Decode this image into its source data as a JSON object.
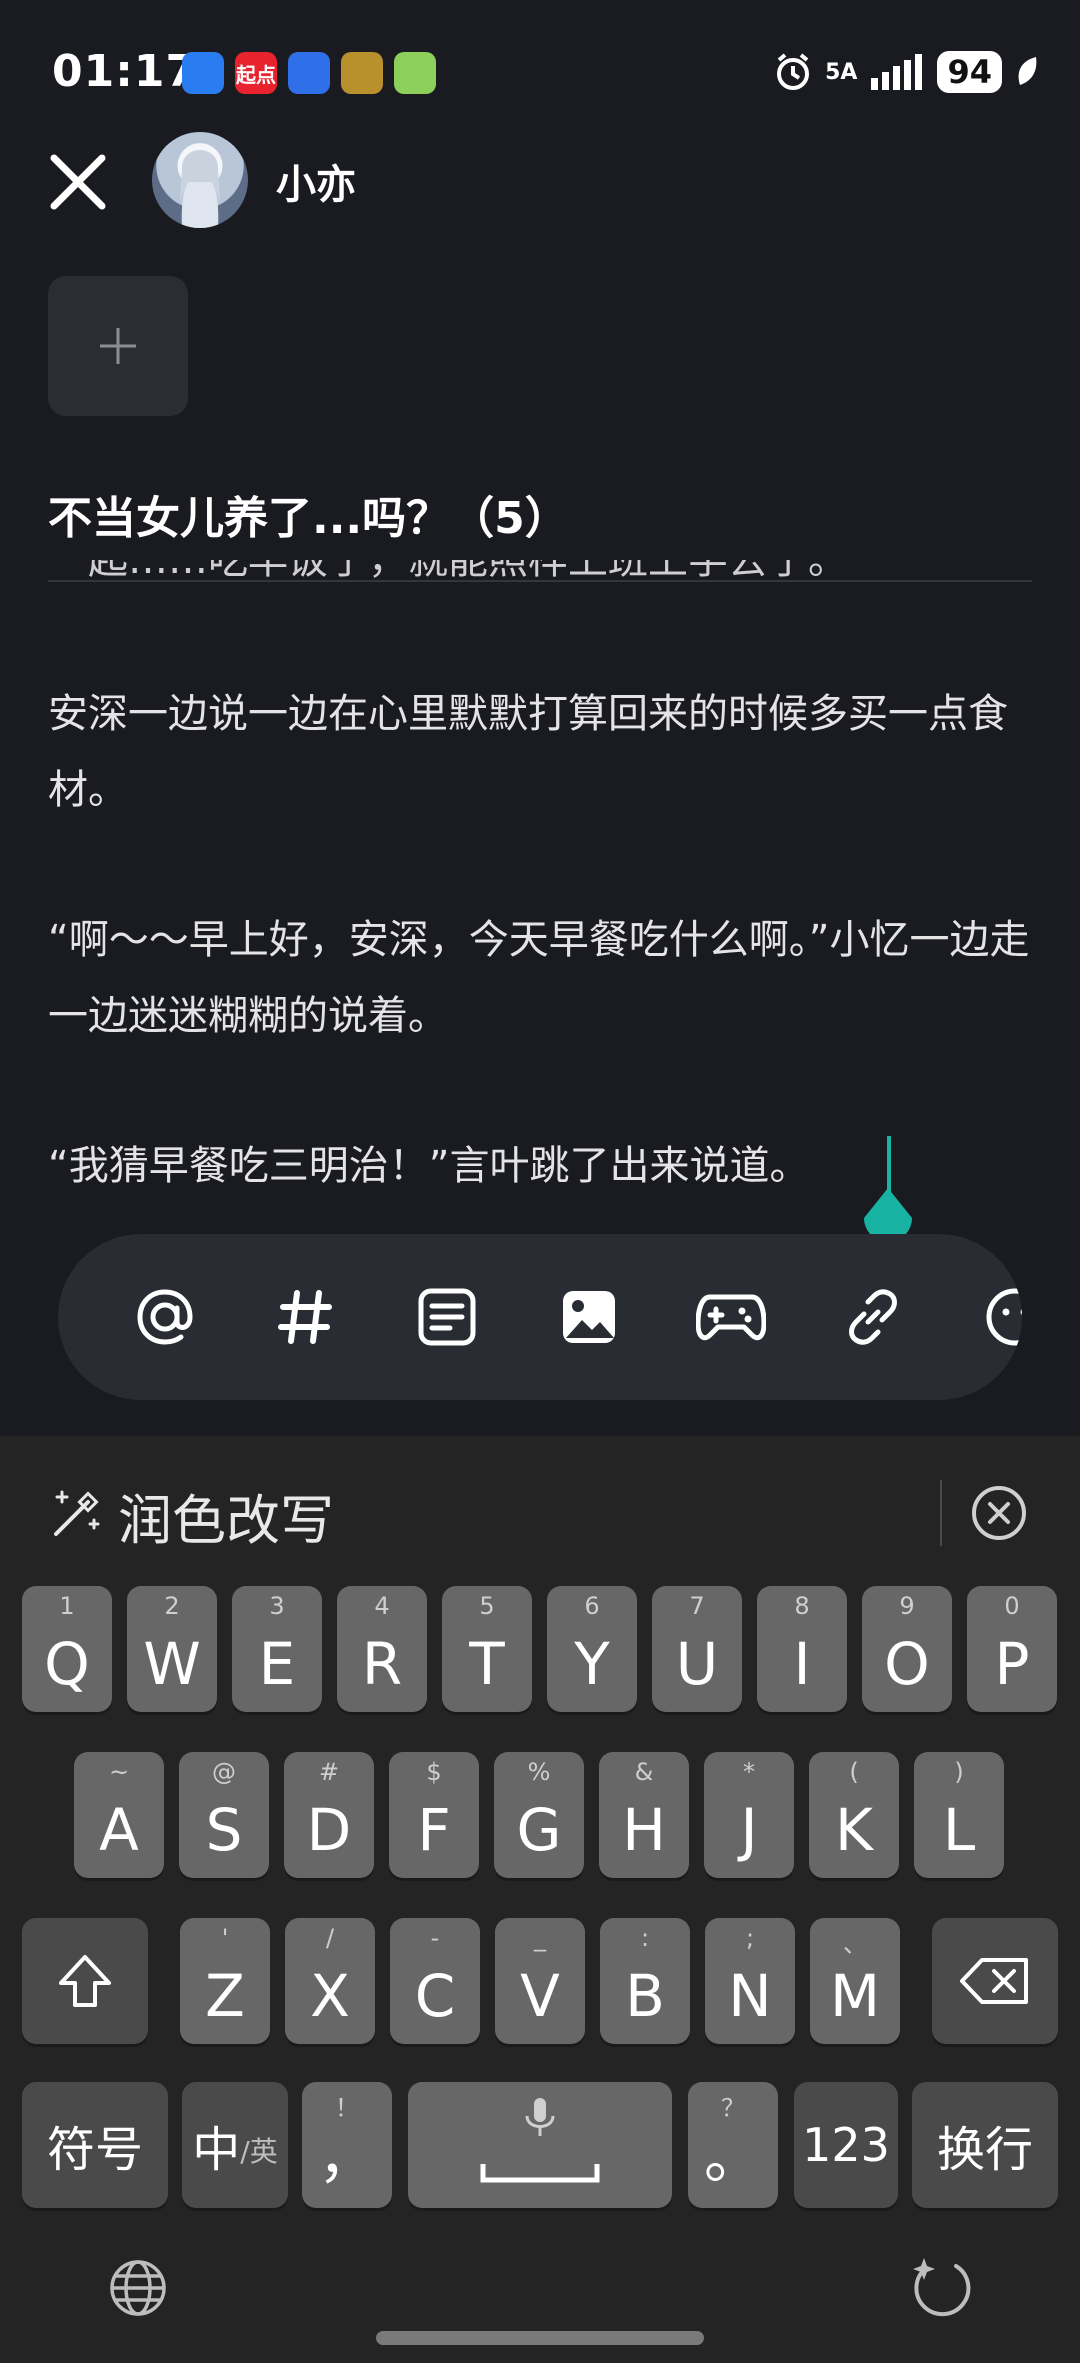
{
  "status_bar": {
    "time": "01:17",
    "network": "5A",
    "battery": "94",
    "app_icons": [
      {
        "name": "message-app-icon",
        "color": "#2a7df0",
        "text": ""
      },
      {
        "name": "qidian-app-icon",
        "color": "#e8232d",
        "text": "起点"
      },
      {
        "name": "upload-app-icon",
        "color": "#2f6fe8",
        "text": ""
      },
      {
        "name": "game-app-icon",
        "color": "#b8912d",
        "text": ""
      },
      {
        "name": "green-app-icon",
        "color": "#8ccf5a",
        "text": ""
      }
    ]
  },
  "header": {
    "username": "小亦"
  },
  "post": {
    "title": "不当女儿养了...吗？（5）",
    "cut_line": "一起……吃早饭了，就能照样上班上学去了。",
    "paragraphs": [
      "安深一边说一边在心里默默打算回来的时候多买一点食材。",
      "“啊～～早上好，安深，今天早餐吃什么啊。”小忆一边走一边迷迷糊糊的说着。",
      "“我猜早餐吃三明治！”言叶跳了出来说道。"
    ]
  },
  "keyboard": {
    "polish_label": "润色改写",
    "row1": [
      {
        "k": "Q",
        "s": "1"
      },
      {
        "k": "W",
        "s": "2"
      },
      {
        "k": "E",
        "s": "3"
      },
      {
        "k": "R",
        "s": "4"
      },
      {
        "k": "T",
        "s": "5"
      },
      {
        "k": "Y",
        "s": "6"
      },
      {
        "k": "U",
        "s": "7"
      },
      {
        "k": "I",
        "s": "8"
      },
      {
        "k": "O",
        "s": "9"
      },
      {
        "k": "P",
        "s": "0"
      }
    ],
    "row2": [
      {
        "k": "A",
        "s": "~"
      },
      {
        "k": "S",
        "s": "@"
      },
      {
        "k": "D",
        "s": "#"
      },
      {
        "k": "F",
        "s": "$"
      },
      {
        "k": "G",
        "s": "%"
      },
      {
        "k": "H",
        "s": "&"
      },
      {
        "k": "J",
        "s": "*"
      },
      {
        "k": "K",
        "s": "("
      },
      {
        "k": "L",
        "s": ")"
      }
    ],
    "row3": [
      {
        "k": "Z",
        "s": "'"
      },
      {
        "k": "X",
        "s": "/"
      },
      {
        "k": "C",
        "s": "-"
      },
      {
        "k": "V",
        "s": "_"
      },
      {
        "k": "B",
        "s": ":"
      },
      {
        "k": "N",
        "s": ";"
      },
      {
        "k": "M",
        "s": "、"
      }
    ],
    "symbols_label": "符号",
    "lang_main": "中",
    "lang_sub": "/英",
    "comma_key": "，",
    "comma_sub": "！",
    "period_key": "。",
    "period_sub": "？",
    "num_label": "123",
    "enter_label": "换行"
  }
}
